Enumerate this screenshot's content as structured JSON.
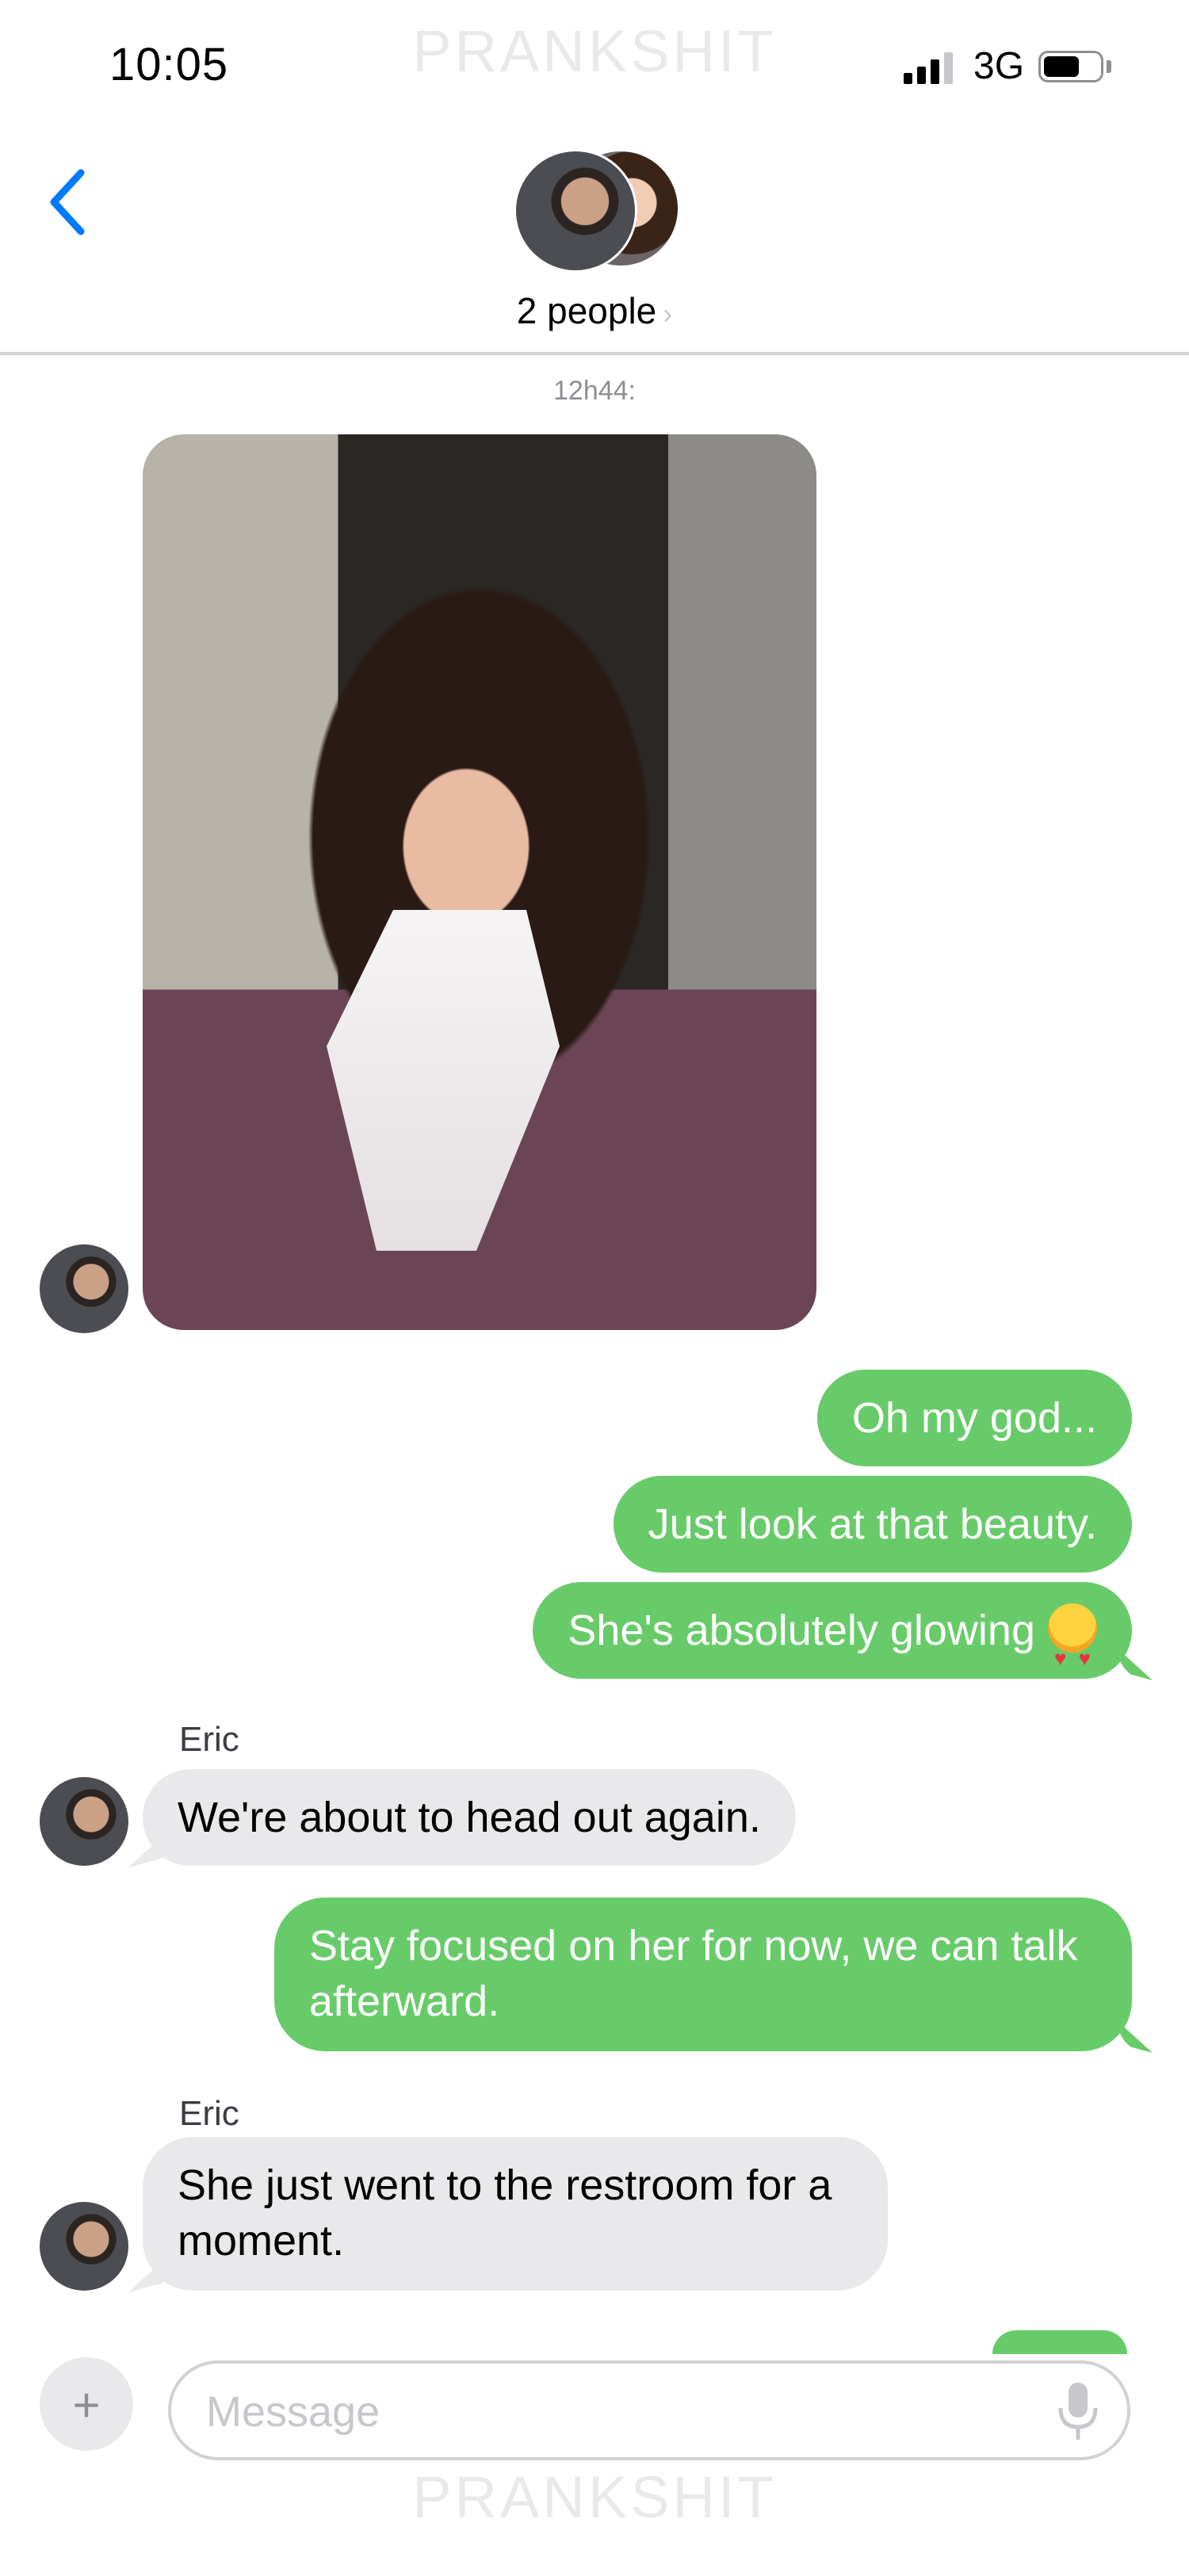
{
  "status_bar": {
    "time": "10:05",
    "network": "3G"
  },
  "watermark": "PRANKSHIT",
  "header": {
    "people_label": "2 people",
    "chevron": "›"
  },
  "conversation": {
    "timestamp": "12h44:",
    "messages": [
      {
        "sender": "contact",
        "type": "photo",
        "alt": "woman-photo"
      },
      {
        "sender": "me",
        "text": "Oh my god..."
      },
      {
        "sender": "me",
        "text": "Just look at that beauty."
      },
      {
        "sender": "me",
        "text": "She's absolutely glowing",
        "emoji": "smiling-face-with-heart-eyes"
      },
      {
        "sender": "contact",
        "name": "Eric",
        "text": "We're about to head out again."
      },
      {
        "sender": "me",
        "text": "Stay focused on her for now, we can talk afterward."
      },
      {
        "sender": "contact",
        "name": "Eric",
        "text": "She just went to the restroom for a moment."
      }
    ]
  },
  "composer": {
    "plus": "+",
    "placeholder": "Message"
  },
  "colors": {
    "outgoing": "#68cb6a",
    "incoming": "#e9e9eb",
    "accent": "#007aff"
  }
}
